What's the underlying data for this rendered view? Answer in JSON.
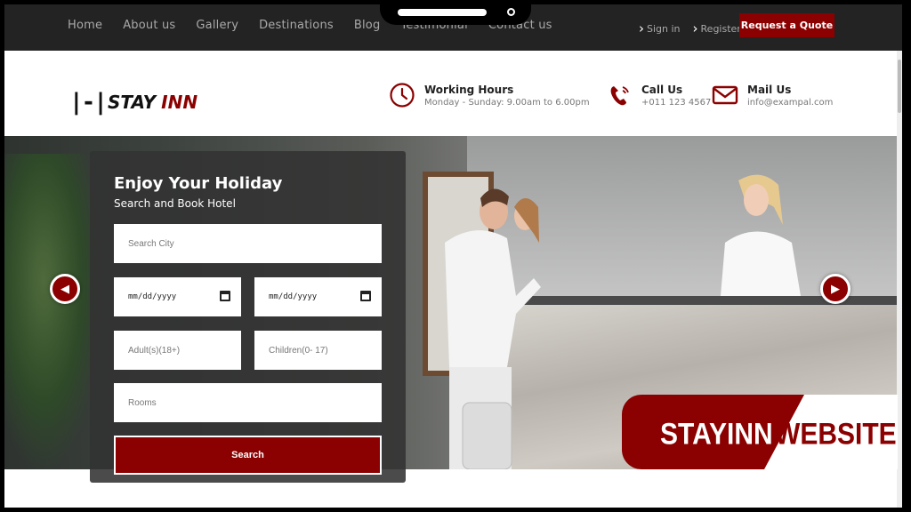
{
  "nav": {
    "items": [
      "Home",
      "About us",
      "Gallery",
      "Destinations",
      "Blog",
      "Testimonial",
      "Contact us"
    ],
    "sign_in": "Sign in",
    "register": "Register",
    "quote_button": "Request a Quote"
  },
  "brand": {
    "logo_mark": "|-|",
    "logo_stay": "STAY",
    "logo_inn": "INN",
    "accent_color": "#8b0000"
  },
  "contact": {
    "hours_title": "Working Hours",
    "hours_text": "Monday - Sunday: 9.00am to 6.00pm",
    "call_title": "Call Us",
    "call_text": "+011 123 4567",
    "mail_title": "Mail Us",
    "mail_text": "info@exampal.com"
  },
  "booking": {
    "title": "Enjoy Your Holiday",
    "subtitle": "Search and Book Hotel",
    "city_placeholder": "Search City",
    "date_in": "mm/dd/yyyy",
    "date_out": "mm/dd/yyyy",
    "adults_placeholder": "Adult(s)(18+)",
    "children_placeholder": "Children(0- 17)",
    "rooms_placeholder": "Rooms",
    "search_button": "Search"
  },
  "banner": {
    "text_left": "STAYINN",
    "text_right": "WEBSITE"
  }
}
